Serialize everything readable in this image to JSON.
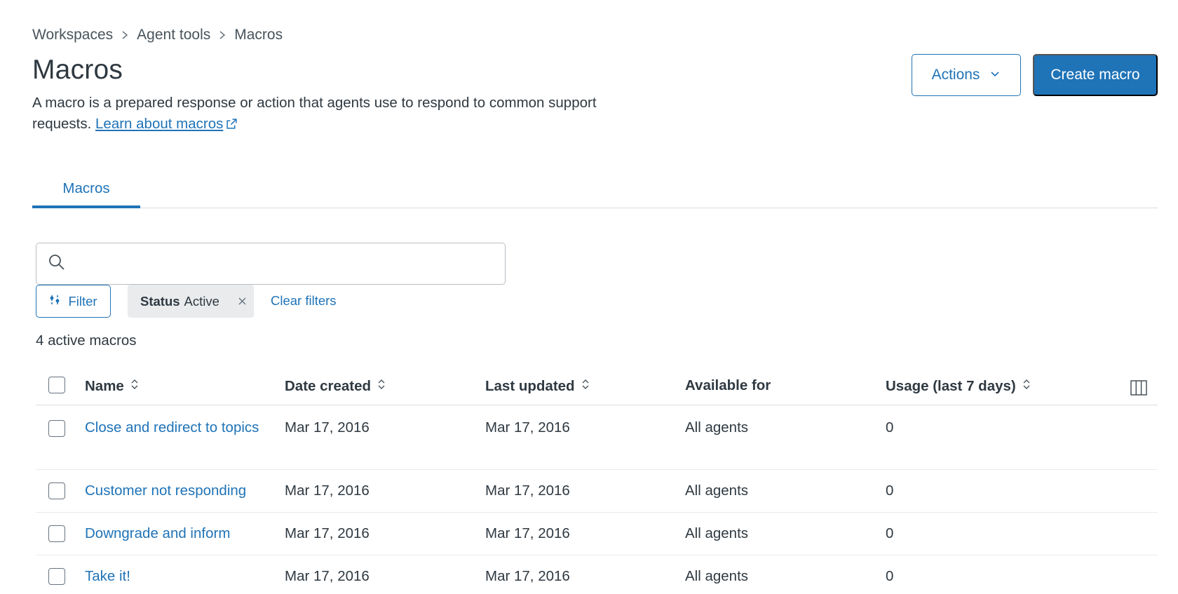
{
  "breadcrumb": [
    "Workspaces",
    "Agent tools",
    "Macros"
  ],
  "page": {
    "title": "Macros",
    "description": "A macro is a prepared response or action that agents use to respond to common support requests.",
    "learn_link": "Learn about macros"
  },
  "header_buttons": {
    "actions": "Actions",
    "create": "Create macro"
  },
  "tabs": [
    {
      "label": "Macros",
      "active": true
    }
  ],
  "search": {
    "placeholder": ""
  },
  "filters": {
    "filter_label": "Filter",
    "chip_key": "Status",
    "chip_value": "Active",
    "clear_label": "Clear filters"
  },
  "count_text": "4 active macros",
  "table": {
    "columns": [
      "Name",
      "Date created",
      "Last updated",
      "Available for",
      "Usage (last 7 days)"
    ],
    "rows": [
      {
        "name": "Close and redirect to topics",
        "created": "Mar 17, 2016",
        "updated": "Mar 17, 2016",
        "available": "All agents",
        "usage": "0"
      },
      {
        "name": "Customer not responding",
        "created": "Mar 17, 2016",
        "updated": "Mar 17, 2016",
        "available": "All agents",
        "usage": "0"
      },
      {
        "name": "Downgrade and inform",
        "created": "Mar 17, 2016",
        "updated": "Mar 17, 2016",
        "available": "All agents",
        "usage": "0"
      },
      {
        "name": "Take it!",
        "created": "Mar 17, 2016",
        "updated": "Mar 17, 2016",
        "available": "All agents",
        "usage": "0"
      }
    ]
  },
  "colors": {
    "accent": "#1f73b7",
    "text": "#2f3941",
    "border": "#d8dcde",
    "chip_bg": "#e9ebed"
  },
  "icons": [
    "chevron-right-icon",
    "external-link-icon",
    "chevron-down-icon",
    "search-icon",
    "filter-icon",
    "close-icon",
    "sort-icon",
    "columns-icon"
  ]
}
